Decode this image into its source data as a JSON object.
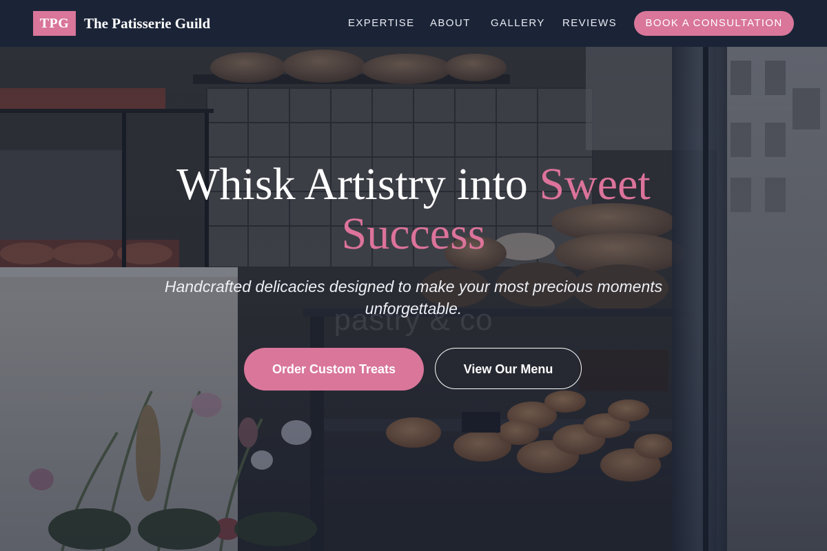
{
  "brand": {
    "badge": "TPG",
    "name": "The Patisserie Guild",
    "accent_color": "#d9769a"
  },
  "nav": {
    "links": [
      "EXPERTISE",
      "ABOUT",
      "GALLERY",
      "REVIEWS"
    ],
    "cta": "BOOK A CONSULTATION"
  },
  "hero": {
    "title_main": "Whisk Artistry into ",
    "title_accent": "Sweet Success",
    "subtitle": "Handcrafted delicacies designed to make your most precious moments unforgettable.",
    "watermark": "pastry & co",
    "primary_button": "Order Custom Treats",
    "secondary_button": "View Our Menu",
    "background_image": "bakery display case with breads, pastries and flowers"
  }
}
